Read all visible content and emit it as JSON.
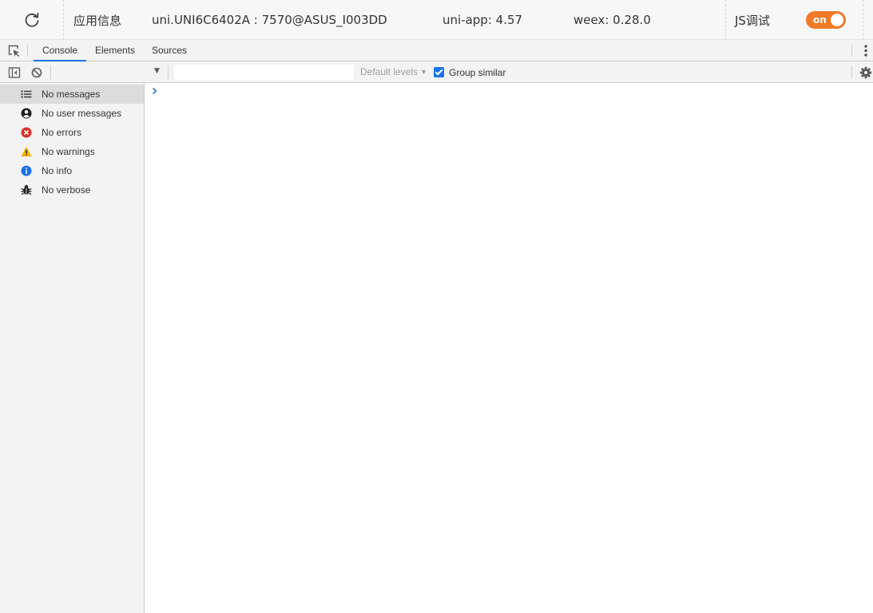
{
  "topbar": {
    "reload_icon": "reload-icon",
    "app_info_label": "应用信息",
    "device": "uni.UNI6C6402A : 7570@ASUS_I003DD",
    "uniapp_version": "uni-app: 4.57",
    "weex_version": "weex: 0.28.0",
    "js_debug_label": "JS调试",
    "toggle_label": "on",
    "toggle_color": "#f07a26"
  },
  "devtools": {
    "tabs": [
      {
        "label": "Console",
        "active": true
      },
      {
        "label": "Elements",
        "active": false
      },
      {
        "label": "Sources",
        "active": false
      }
    ],
    "accent": "#1a73e8"
  },
  "console_toolbar": {
    "filter_value": "",
    "levels_label": "Default levels",
    "group_similar_label": "Group similar",
    "group_similar_checked": true
  },
  "sidebar": {
    "items": [
      {
        "label": "No messages",
        "icon": "list-icon",
        "selected": true
      },
      {
        "label": "No user messages",
        "icon": "user-icon",
        "selected": false
      },
      {
        "label": "No errors",
        "icon": "error-icon",
        "selected": false
      },
      {
        "label": "No warnings",
        "icon": "warning-icon",
        "selected": false
      },
      {
        "label": "No info",
        "icon": "info-icon",
        "selected": false
      },
      {
        "label": "No verbose",
        "icon": "bug-icon",
        "selected": false
      }
    ]
  },
  "colors": {
    "error": "#d93025",
    "warning": "#f4b400",
    "info": "#1a73e8"
  }
}
